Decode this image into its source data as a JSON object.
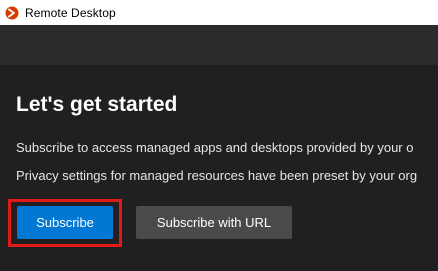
{
  "window": {
    "title": "Remote Desktop",
    "icon": "remote-desktop-icon"
  },
  "main": {
    "heading": "Let's get started",
    "line1": "Subscribe to access managed apps and desktops provided by your o",
    "line2": "Privacy settings for managed resources have been preset by your org"
  },
  "buttons": {
    "subscribe": "Subscribe",
    "subscribe_url": "Subscribe with URL"
  },
  "colors": {
    "accent": "#0078d4",
    "highlight": "#e01919",
    "background": "#202020"
  }
}
